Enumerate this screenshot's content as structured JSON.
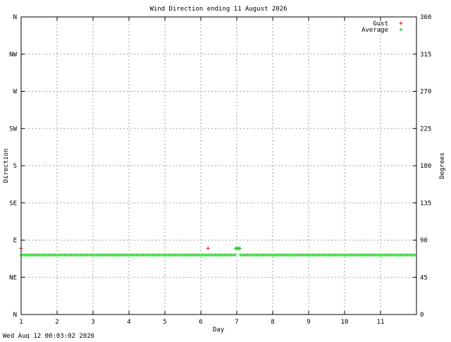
{
  "chart_data": {
    "type": "scatter",
    "title": "Wind Direction ending 11 August 2026",
    "xlabel": "Day",
    "ylabel_left": "Direction",
    "ylabel_right": "Degrees",
    "footer": "Wed Aug 12 00:03:02 2026",
    "xlim": [
      1,
      12
    ],
    "ylim": [
      0,
      360
    ],
    "grid": true,
    "legend_position": "top-right",
    "x_ticks": [
      {
        "value": 1,
        "label": "1"
      },
      {
        "value": 2,
        "label": "2"
      },
      {
        "value": 3,
        "label": "3"
      },
      {
        "value": 4,
        "label": "4"
      },
      {
        "value": 5,
        "label": "5"
      },
      {
        "value": 6,
        "label": "6"
      },
      {
        "value": 7,
        "label": "7"
      },
      {
        "value": 8,
        "label": "8"
      },
      {
        "value": 9,
        "label": "9"
      },
      {
        "value": 10,
        "label": "10"
      },
      {
        "value": 11,
        "label": "11"
      }
    ],
    "y_ticks_left": [
      {
        "value": 0,
        "label": "N"
      },
      {
        "value": 45,
        "label": "NE"
      },
      {
        "value": 90,
        "label": "E"
      },
      {
        "value": 135,
        "label": "SE"
      },
      {
        "value": 180,
        "label": "S"
      },
      {
        "value": 225,
        "label": "SW"
      },
      {
        "value": 270,
        "label": "W"
      },
      {
        "value": 315,
        "label": "NW"
      },
      {
        "value": 360,
        "label": "N"
      }
    ],
    "y_ticks_right": [
      {
        "value": 0,
        "label": "0"
      },
      {
        "value": 45,
        "label": "45"
      },
      {
        "value": 90,
        "label": "90"
      },
      {
        "value": 135,
        "label": "135"
      },
      {
        "value": 180,
        "label": "180"
      },
      {
        "value": 225,
        "label": "225"
      },
      {
        "value": 270,
        "label": "270"
      },
      {
        "value": 315,
        "label": "315"
      },
      {
        "value": 360,
        "label": "360"
      }
    ],
    "series": [
      {
        "name": "Gust",
        "color": "#ff0000",
        "marker": "plus",
        "points": [
          {
            "x": 1.0,
            "y": 80
          },
          {
            "x": 6.2,
            "y": 80
          }
        ]
      },
      {
        "name": "Average",
        "color": "#00cc00",
        "marker": "plus",
        "segments": [
          {
            "x_start": 1.0,
            "x_end": 6.95,
            "step": 0.05,
            "y": 72
          },
          {
            "x_start": 7.1,
            "x_end": 11.95,
            "step": 0.05,
            "y": 72
          }
        ],
        "points": [
          {
            "x": 6.97,
            "y": 80
          },
          {
            "x": 7.0,
            "y": 80
          },
          {
            "x": 7.03,
            "y": 80
          },
          {
            "x": 7.06,
            "y": 80
          },
          {
            "x": 7.09,
            "y": 80
          }
        ]
      }
    ]
  }
}
